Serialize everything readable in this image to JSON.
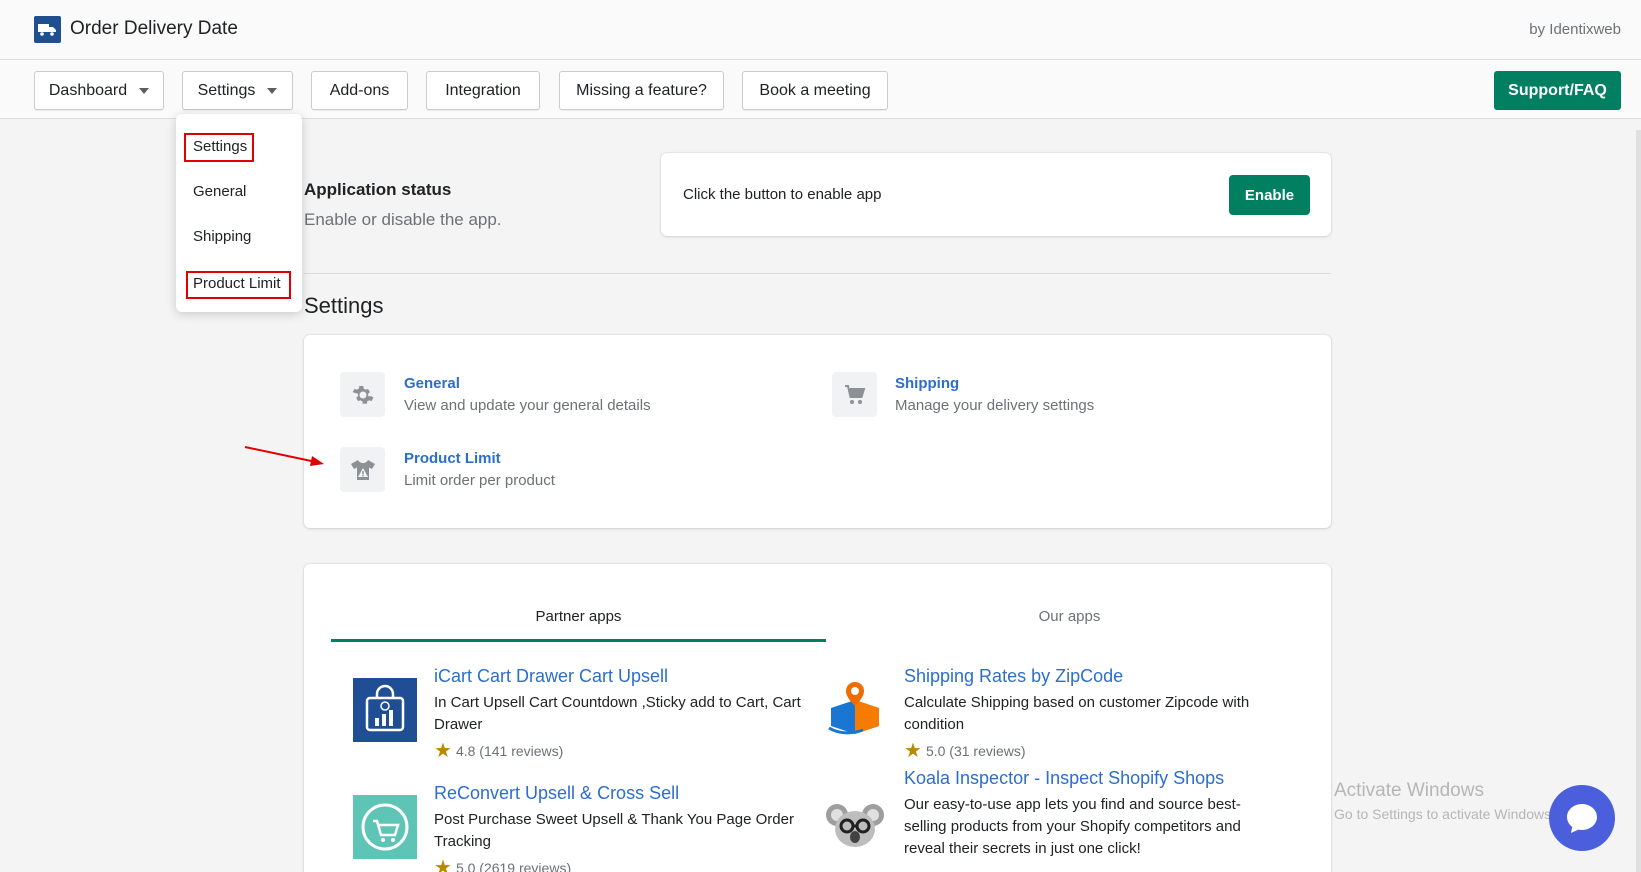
{
  "header": {
    "title": "Order Delivery Date",
    "byline": "by Identixweb"
  },
  "nav": {
    "dashboard": "Dashboard",
    "settings": "Settings",
    "addons": "Add-ons",
    "integration": "Integration",
    "missing": "Missing a feature?",
    "book": "Book a meeting",
    "support": "Support/FAQ"
  },
  "dropdown": {
    "items": [
      "Settings",
      "General",
      "Shipping",
      "Product Limit"
    ]
  },
  "app_status": {
    "title": "Application status",
    "subtitle": "Enable or disable the app.",
    "card_text": "Click the button to enable app",
    "enable_label": "Enable"
  },
  "settings": {
    "heading": "Settings",
    "items": [
      {
        "title": "General",
        "desc": "View and update your general details",
        "icon": "gear-icon"
      },
      {
        "title": "Shipping",
        "desc": "Manage your delivery settings",
        "icon": "cart-icon"
      },
      {
        "title": "Product Limit",
        "desc": "Limit order per product",
        "icon": "shirt-warning-icon"
      }
    ]
  },
  "apps": {
    "tabs": [
      "Partner apps",
      "Our apps"
    ],
    "list": [
      {
        "name": "iCart Cart Drawer Cart Upsell",
        "desc": "In Cart Upsell Cart Countdown ,Sticky add to Cart, Cart Drawer",
        "rating": "4.8 (141 reviews)"
      },
      {
        "name": "Shipping Rates by ZipCode",
        "desc": "Calculate Shipping based on customer Zipcode with condition",
        "rating": "5.0 (31 reviews)"
      },
      {
        "name": "ReConvert Upsell & Cross Sell",
        "desc": "Post Purchase Sweet Upsell & Thank You Page Order Tracking",
        "rating": "5.0 (2619 reviews)"
      },
      {
        "name": "Koala Inspector - Inspect Shopify Shops",
        "desc": "Our easy-to-use app lets you find and source best-selling products from your Shopify competitors and reveal their secrets in just one click!",
        "rating": ""
      }
    ]
  },
  "watermark": {
    "line1": "Activate Windows",
    "line2": "Go to Settings to activate Windows."
  },
  "colors": {
    "accent": "#008060",
    "link": "#2c6ecb",
    "highlight": "#e00000"
  }
}
